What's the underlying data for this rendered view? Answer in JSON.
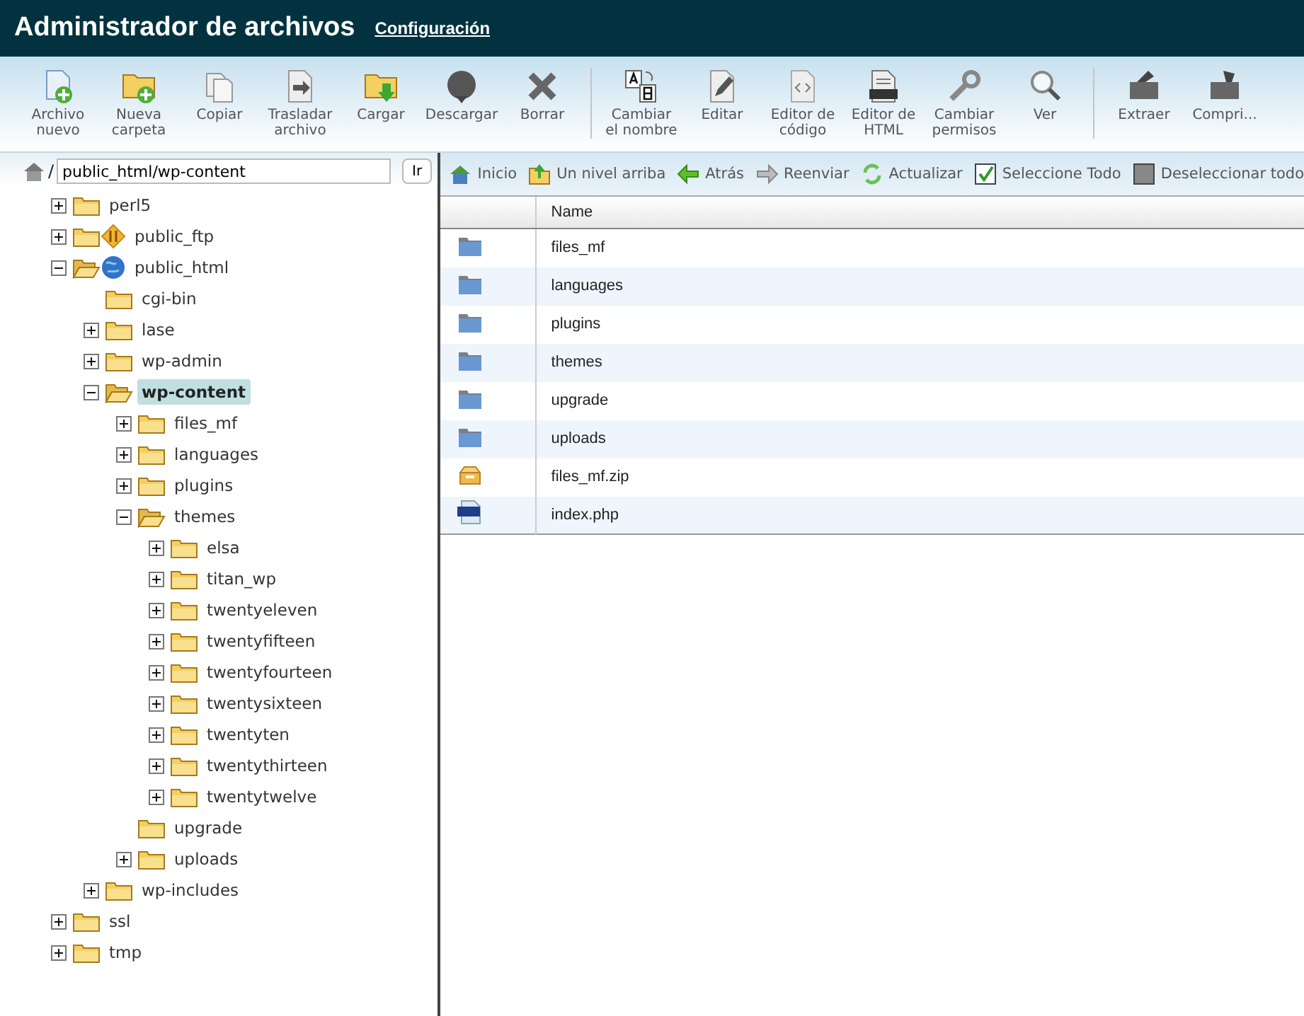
{
  "header": {
    "title": "Administrador de archivos",
    "link": "Configuración"
  },
  "toolbar": [
    {
      "kind": "new-file",
      "label": "Archivo nuevo"
    },
    {
      "kind": "new-folder",
      "label": "Nueva carpeta"
    },
    {
      "kind": "copy",
      "label": "Copiar"
    },
    {
      "kind": "move",
      "label": "Trasladar archivo"
    },
    {
      "kind": "upload",
      "label": "Cargar"
    },
    {
      "kind": "download",
      "label": "Descargar"
    },
    {
      "kind": "delete",
      "label": "Borrar"
    },
    {
      "kind": "separator"
    },
    {
      "kind": "rename",
      "label": "Cambiar el nombre"
    },
    {
      "kind": "edit",
      "label": "Editar"
    },
    {
      "kind": "code",
      "label": "Editor de código"
    },
    {
      "kind": "html",
      "label": "Editor de HTML"
    },
    {
      "kind": "permissions",
      "label": "Cambiar permisos"
    },
    {
      "kind": "view",
      "label": "Ver"
    },
    {
      "kind": "separator"
    },
    {
      "kind": "extract",
      "label": "Extraer"
    },
    {
      "kind": "compress",
      "label": "Compri..."
    }
  ],
  "path": {
    "separator": "/",
    "value": "public_html/wp-content",
    "button": "Ir"
  },
  "tree": [
    {
      "label": "perl5",
      "expanded": false,
      "has_toggle": true,
      "selected": false
    },
    {
      "label": "public_ftp",
      "expanded": false,
      "has_toggle": true,
      "selected": false,
      "kind": "ftp"
    },
    {
      "label": "public_html",
      "expanded": true,
      "has_toggle": true,
      "selected": false,
      "kind": "web",
      "children": [
        {
          "label": "cgi-bin",
          "expanded": false,
          "has_toggle": false,
          "selected": false
        },
        {
          "label": "lase",
          "expanded": false,
          "has_toggle": true,
          "selected": false
        },
        {
          "label": "wp-admin",
          "expanded": false,
          "has_toggle": true,
          "selected": false
        },
        {
          "label": "wp-content",
          "expanded": true,
          "has_toggle": true,
          "selected": true,
          "children": [
            {
              "label": "files_mf",
              "expanded": false,
              "has_toggle": true,
              "selected": false
            },
            {
              "label": "languages",
              "expanded": false,
              "has_toggle": true,
              "selected": false
            },
            {
              "label": "plugins",
              "expanded": false,
              "has_toggle": true,
              "selected": false
            },
            {
              "label": "themes",
              "expanded": true,
              "has_toggle": true,
              "selected": false,
              "children": [
                {
                  "label": "elsa",
                  "expanded": false,
                  "has_toggle": true,
                  "selected": false
                },
                {
                  "label": "titan_wp",
                  "expanded": false,
                  "has_toggle": true,
                  "selected": false
                },
                {
                  "label": "twentyeleven",
                  "expanded": false,
                  "has_toggle": true,
                  "selected": false
                },
                {
                  "label": "twentyfifteen",
                  "expanded": false,
                  "has_toggle": true,
                  "selected": false
                },
                {
                  "label": "twentyfourteen",
                  "expanded": false,
                  "has_toggle": true,
                  "selected": false
                },
                {
                  "label": "twentysixteen",
                  "expanded": false,
                  "has_toggle": true,
                  "selected": false
                },
                {
                  "label": "twentyten",
                  "expanded": false,
                  "has_toggle": true,
                  "selected": false
                },
                {
                  "label": "twentythirteen",
                  "expanded": false,
                  "has_toggle": true,
                  "selected": false
                },
                {
                  "label": "twentytwelve",
                  "expanded": false,
                  "has_toggle": true,
                  "selected": false
                }
              ]
            },
            {
              "label": "upgrade",
              "expanded": false,
              "has_toggle": false,
              "selected": false
            },
            {
              "label": "uploads",
              "expanded": false,
              "has_toggle": true,
              "selected": false
            }
          ]
        },
        {
          "label": "wp-includes",
          "expanded": false,
          "has_toggle": true,
          "selected": false
        }
      ]
    },
    {
      "label": "ssl",
      "expanded": false,
      "has_toggle": true,
      "selected": false
    },
    {
      "label": "tmp",
      "expanded": false,
      "has_toggle": true,
      "selected": false
    }
  ],
  "nav": [
    {
      "kind": "home",
      "label": "Inicio"
    },
    {
      "kind": "up",
      "label": "Un nivel arriba"
    },
    {
      "kind": "back",
      "label": "Atrás"
    },
    {
      "kind": "forward",
      "label": "Reenviar"
    },
    {
      "kind": "refresh",
      "label": "Actualizar"
    },
    {
      "kind": "select-all",
      "label": "Seleccione Todo"
    },
    {
      "kind": "deselect-all",
      "label": "Deseleccionar todo"
    }
  ],
  "table": {
    "columns": [
      "Name"
    ],
    "rows": [
      {
        "kind": "folder",
        "name": "files_mf"
      },
      {
        "kind": "folder",
        "name": "languages"
      },
      {
        "kind": "folder",
        "name": "plugins"
      },
      {
        "kind": "folder",
        "name": "themes"
      },
      {
        "kind": "folder",
        "name": "upgrade"
      },
      {
        "kind": "folder",
        "name": "uploads"
      },
      {
        "kind": "zip",
        "name": "files_mf.zip"
      },
      {
        "kind": "php",
        "name": "index.php"
      }
    ]
  }
}
